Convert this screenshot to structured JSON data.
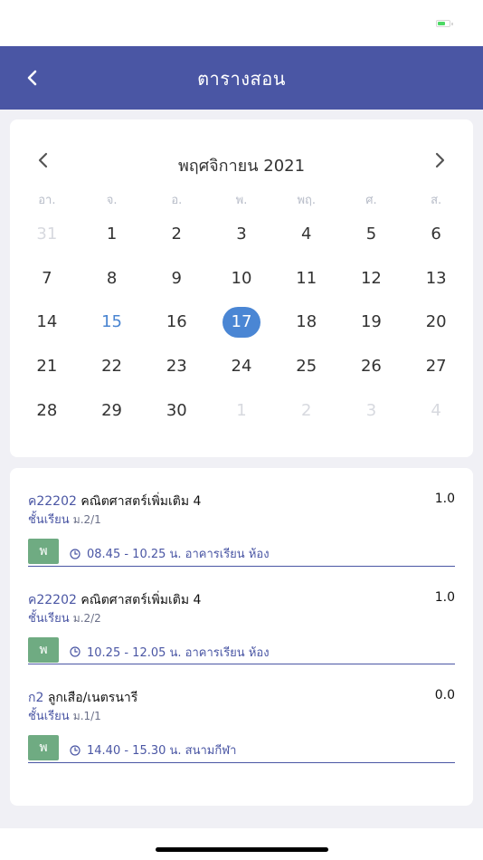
{
  "header": {
    "title": "ตารางสอน"
  },
  "calendar": {
    "month_label": "พฤศจิกายน 2021",
    "weekdays": [
      "อา.",
      "จ.",
      "อ.",
      "พ.",
      "พฤ.",
      "ศ.",
      "ส."
    ],
    "days": [
      [
        "31",
        "1",
        "2",
        "3",
        "4",
        "5",
        "6"
      ],
      [
        "7",
        "8",
        "9",
        "10",
        "11",
        "12",
        "13"
      ],
      [
        "14",
        "15",
        "16",
        "17",
        "18",
        "19",
        "20"
      ],
      [
        "21",
        "22",
        "23",
        "24",
        "25",
        "26",
        "27"
      ],
      [
        "28",
        "29",
        "30",
        "1",
        "2",
        "3",
        "4"
      ]
    ],
    "today": "15",
    "selected": "17"
  },
  "schedule": [
    {
      "code": "ค22202",
      "name": "คณิตศาสตร์เพิ่มเติม 4",
      "credits": "1.0",
      "class_label": "ชั้นเรียน",
      "class_level": "ม.2/1",
      "day_badge": "พ",
      "time": "08.45 - 10.25 น. อาคารเรียน  ห้อง"
    },
    {
      "code": "ค22202",
      "name": "คณิตศาสตร์เพิ่มเติม 4",
      "credits": "1.0",
      "class_label": "ชั้นเรียน",
      "class_level": "ม.2/2",
      "day_badge": "พ",
      "time": "10.25 - 12.05 น. อาคารเรียน  ห้อง"
    },
    {
      "code": "ก2",
      "name": "ลูกเสือ/เนตรนารี",
      "credits": "0.0",
      "class_label": "ชั้นเรียน",
      "class_level": "ม.1/1",
      "day_badge": "พ",
      "time": "14.40 - 15.30 น. สนามกีฬา"
    }
  ],
  "colors": {
    "header_bg": "#4a56a4",
    "selected_day": "#4a86d4",
    "today": "#4a85d1",
    "badge": "#6fab82"
  },
  "icons": {
    "back": "chevron-left-icon",
    "prev_month": "chevron-left-icon",
    "next_month": "chevron-right-icon",
    "time": "clock-icon",
    "battery": "battery-icon"
  }
}
